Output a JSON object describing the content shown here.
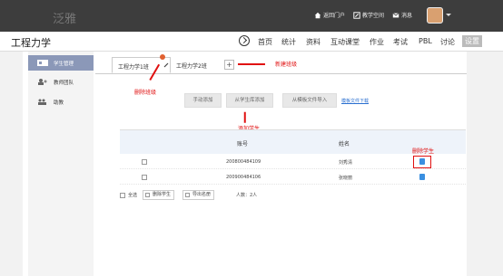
{
  "topbar": {
    "brand": "泛雅",
    "links": [
      "返回门户",
      "教学空间",
      "消息"
    ]
  },
  "secbar": {
    "course_title": "工程力学",
    "nav": [
      "首页",
      "统计",
      "资料",
      "互动课堂",
      "作业",
      "考试",
      "PBL",
      "讨论",
      "设置"
    ]
  },
  "sidebar": {
    "items": [
      {
        "label": "学生管理",
        "icon": "student-card-icon"
      },
      {
        "label": "教师团队",
        "icon": "teacher-team-icon"
      },
      {
        "label": "助教",
        "icon": "assistant-icon"
      }
    ]
  },
  "tabs": {
    "items": [
      "工程力学1班",
      "工程力学2班"
    ],
    "add_label": "+"
  },
  "annotations": {
    "new_class": "新建班级",
    "delete_class": "删除班级",
    "add_student": "添加学生",
    "delete_student": "删除学生"
  },
  "actions": {
    "manual_add": "手动添加",
    "from_library": "从学生库添加",
    "from_template": "从模板文件导入",
    "template_download": "模板文件下载"
  },
  "table": {
    "headers": [
      "账号",
      "姓名"
    ],
    "rows": [
      {
        "account": "200800484109",
        "name": "刘秀清"
      },
      {
        "account": "200900484106",
        "name": "张晓丽"
      }
    ]
  },
  "footer": {
    "select_all": "全选",
    "delete_student": "删除学生",
    "export": "导出名册",
    "count": "人数：2人"
  },
  "colors": {
    "topbar": "#3d3d3d",
    "sidebar_active": "#8b98b8",
    "annotation": "#e01010",
    "link": "#2a6fd0",
    "trash": "#3a8fe0"
  }
}
